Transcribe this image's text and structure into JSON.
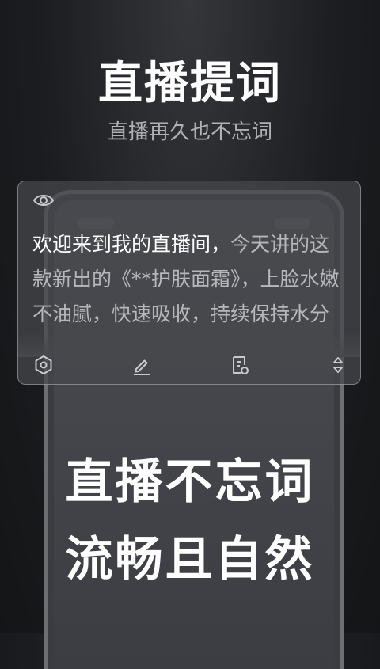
{
  "header": {
    "title": "直播提词",
    "subtitle": "直播再久也不忘词"
  },
  "teleprompter": {
    "highlight_text": "欢迎来到我的直播间，",
    "body_text": "今天讲的这款新出的《**护肤面霜》，上脸水嫩不油腻，快速吸收，持续保持水分",
    "icons": [
      "eye-icon",
      "settings-hexagon-icon",
      "edit-pen-icon",
      "script-list-icon",
      "up-down-arrows-icon"
    ]
  },
  "promo": {
    "line1": "直播不忘词",
    "line2": "流畅且自然"
  },
  "colors": {
    "background": "#1c1d20",
    "text_primary": "#ffffff",
    "text_secondary": "#b7b8bb"
  }
}
